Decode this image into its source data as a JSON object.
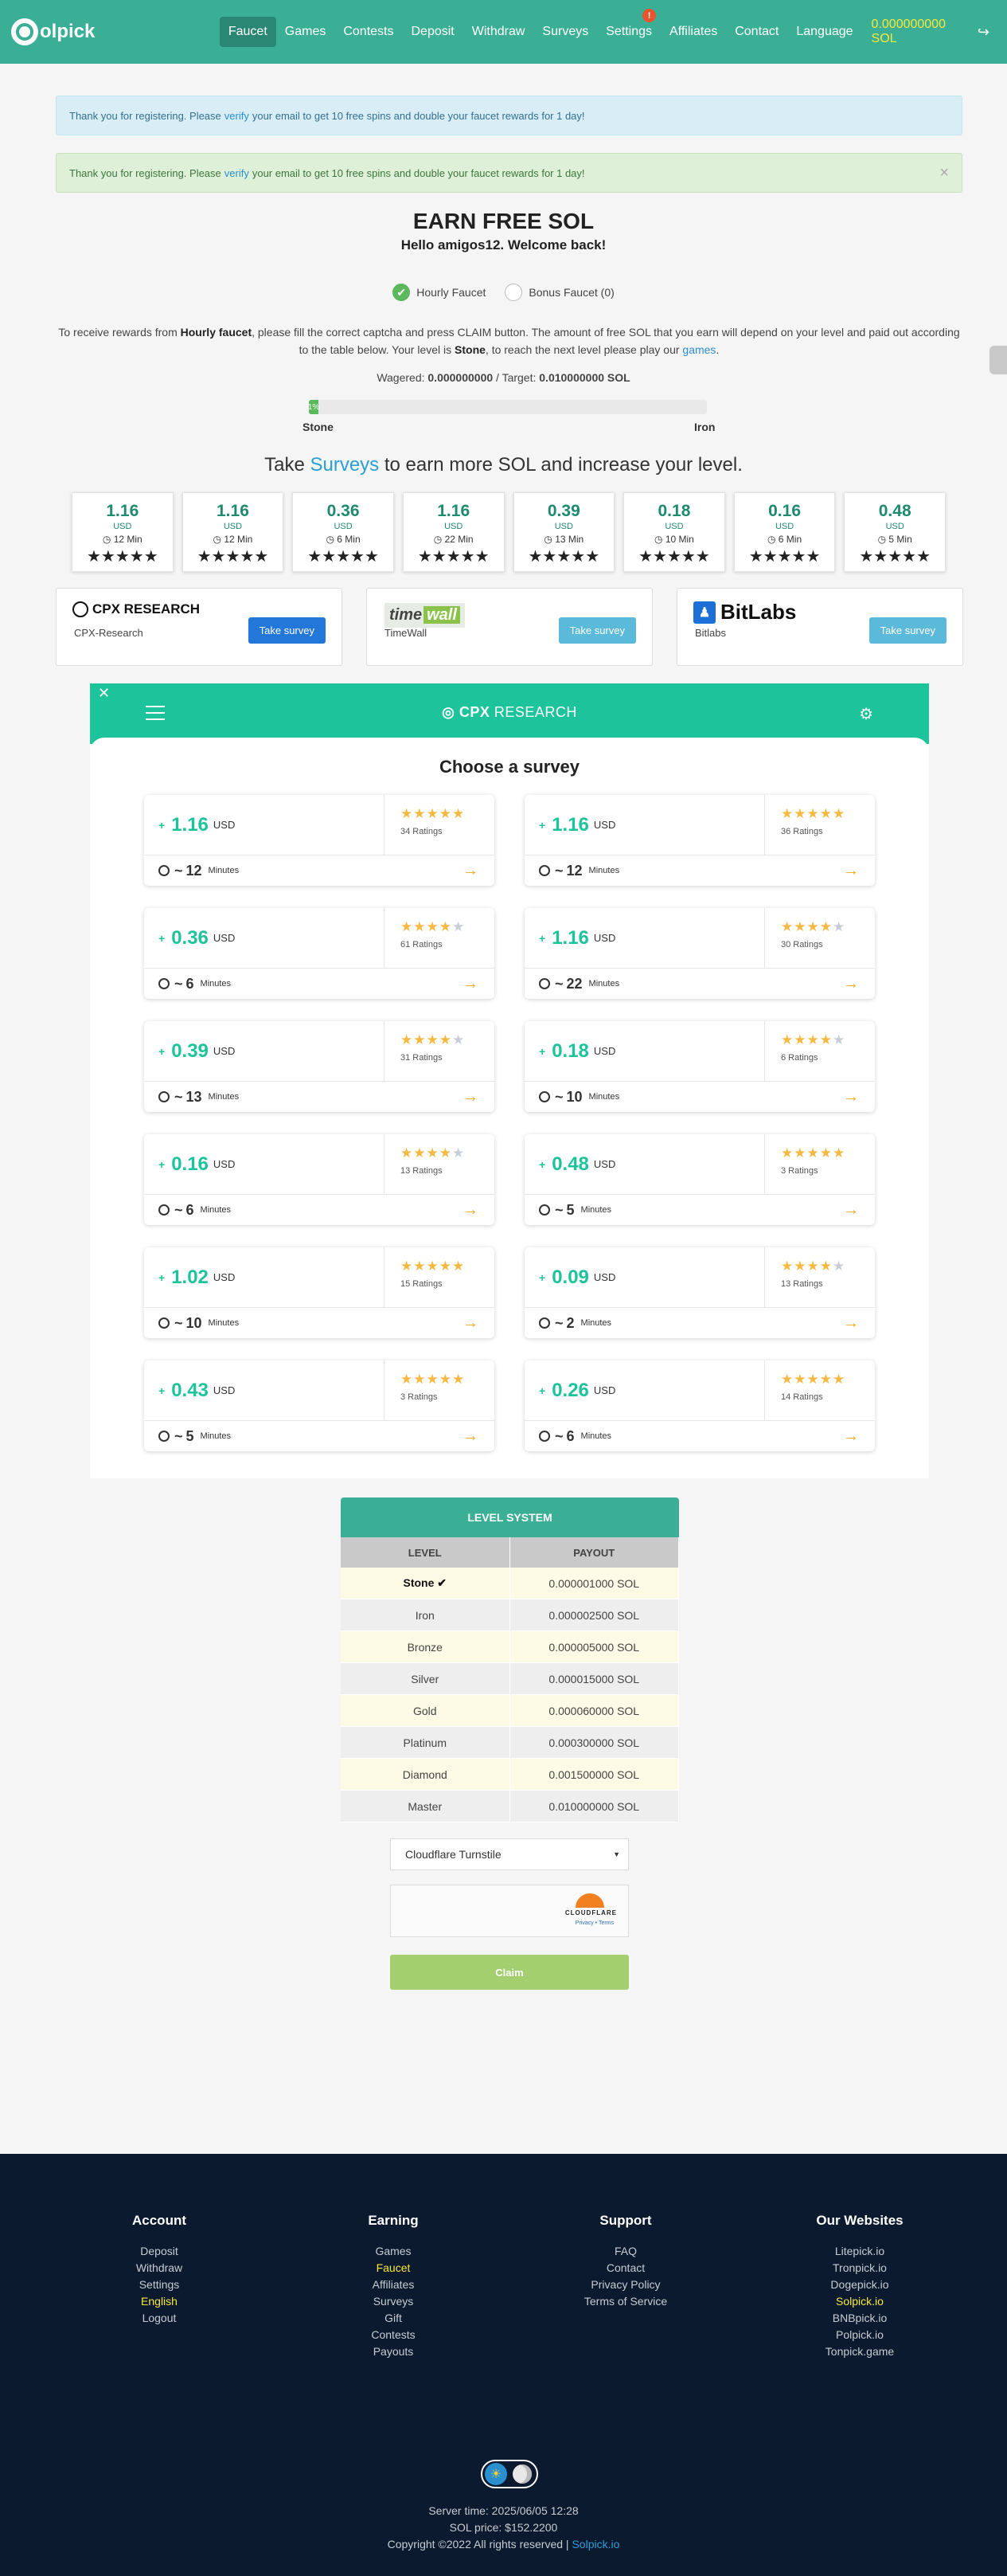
{
  "nav": {
    "logo_text": "olpick",
    "items": [
      {
        "label": "Faucet",
        "active": true
      },
      {
        "label": "Games"
      },
      {
        "label": "Contests"
      },
      {
        "label": "Deposit"
      },
      {
        "label": "Withdraw"
      },
      {
        "label": "Surveys"
      },
      {
        "label": "Settings",
        "badge": "!"
      },
      {
        "label": "Affiliates"
      },
      {
        "label": "Contact"
      },
      {
        "label": "Language"
      }
    ],
    "balance": "0.000000000 SOL"
  },
  "alerts": {
    "info": {
      "before": "Thank you for registering. Please",
      "link": "verify",
      "after": "your email to get 10 free spins and double your faucet rewards for 1 day!"
    },
    "success": {
      "before": "Thank you for registering. Please",
      "link": "verify",
      "after": "your email to get 10 free spins and double your faucet rewards for 1 day!",
      "close": "×"
    }
  },
  "main": {
    "title": "EARN FREE SOL",
    "greeting": "Hello amigos12. Welcome back!",
    "faucet_options": [
      "Hourly Faucet",
      "Bonus Faucet (0)"
    ],
    "desc": {
      "p1": "To receive rewards from",
      "b1": "Hourly faucet",
      "p2": ", please fill the correct captcha and press CLAIM button. The amount of free SOL that you earn will depend on your level and paid out according to the table below. Your level is",
      "b2": "Stone",
      "p3": ", to reach the next level please play our",
      "link": "games",
      "p4": "."
    },
    "wagered_label": "Wagered:",
    "wagered": "0.000000000",
    "target_label": "/ Target:",
    "target": "0.010000000 SOL",
    "progress": {
      "percent": 1,
      "label": "1%",
      "from": "Stone",
      "to": "Iron"
    },
    "take": {
      "before": "Take",
      "link": "Surveys",
      "after": "to earn more SOL and increase your level."
    }
  },
  "mini_surveys": [
    {
      "value": "1.16",
      "unit": "USD",
      "time": "12 Min",
      "stars": "★★★★★"
    },
    {
      "value": "1.16",
      "unit": "USD",
      "time": "12 Min",
      "stars": "★★★★★"
    },
    {
      "value": "0.36",
      "unit": "USD",
      "time": "6 Min",
      "stars": "★★★★★"
    },
    {
      "value": "1.16",
      "unit": "USD",
      "time": "22 Min",
      "stars": "★★★★★"
    },
    {
      "value": "0.39",
      "unit": "USD",
      "time": "13 Min",
      "stars": "★★★★★"
    },
    {
      "value": "0.18",
      "unit": "USD",
      "time": "10 Min",
      "stars": "★★★★★"
    },
    {
      "value": "0.16",
      "unit": "USD",
      "time": "6 Min",
      "stars": "★★★★★"
    },
    {
      "value": "0.48",
      "unit": "USD",
      "time": "5 Min",
      "stars": "★★★★★"
    }
  ],
  "providers": [
    {
      "logo": "CPX RESEARCH",
      "name": "CPX-Research",
      "button": "Take survey"
    },
    {
      "logo_a": "time",
      "logo_b": "wall",
      "name": "TimeWall",
      "button": "Take survey"
    },
    {
      "logo": "BitLabs",
      "logo_mark": "♟",
      "name": "Bitlabs",
      "button": "Take survey"
    }
  ],
  "cpx": {
    "close": "✕",
    "brand_a": "CPX",
    "brand_b": "RESEARCH",
    "filter": "⚙",
    "heading": "Choose a survey",
    "surveys": [
      {
        "amount": "1.16",
        "currency": "USD",
        "rating": 5,
        "ratings": "34 Ratings",
        "minutes": "12",
        "min_label": "Minutes"
      },
      {
        "amount": "1.16",
        "currency": "USD",
        "rating": 5,
        "ratings": "36 Ratings",
        "minutes": "12",
        "min_label": "Minutes"
      },
      {
        "amount": "0.36",
        "currency": "USD",
        "rating": 4,
        "ratings": "61 Ratings",
        "minutes": "6",
        "min_label": "Minutes"
      },
      {
        "amount": "1.16",
        "currency": "USD",
        "rating": 4,
        "ratings": "30 Ratings",
        "minutes": "22",
        "min_label": "Minutes"
      },
      {
        "amount": "0.39",
        "currency": "USD",
        "rating": 4,
        "ratings": "31 Ratings",
        "minutes": "13",
        "min_label": "Minutes"
      },
      {
        "amount": "0.18",
        "currency": "USD",
        "rating": 4,
        "ratings": "6 Ratings",
        "minutes": "10",
        "min_label": "Minutes"
      },
      {
        "amount": "0.16",
        "currency": "USD",
        "rating": 4,
        "ratings": "13 Ratings",
        "minutes": "6",
        "min_label": "Minutes"
      },
      {
        "amount": "0.48",
        "currency": "USD",
        "rating": 5,
        "ratings": "3 Ratings",
        "minutes": "5",
        "min_label": "Minutes"
      },
      {
        "amount": "1.02",
        "currency": "USD",
        "rating": 5,
        "ratings": "15 Ratings",
        "minutes": "10",
        "min_label": "Minutes"
      },
      {
        "amount": "0.09",
        "currency": "USD",
        "rating": 4,
        "ratings": "13 Ratings",
        "minutes": "2",
        "min_label": "Minutes"
      },
      {
        "amount": "0.43",
        "currency": "USD",
        "rating": 5,
        "ratings": "3 Ratings",
        "minutes": "5",
        "min_label": "Minutes"
      },
      {
        "amount": "0.26",
        "currency": "USD",
        "rating": 5,
        "ratings": "14 Ratings",
        "minutes": "6",
        "min_label": "Minutes"
      }
    ]
  },
  "level_system": {
    "title": "LEVEL SYSTEM",
    "col_level": "LEVEL",
    "col_payout": "PAYOUT",
    "rows": [
      {
        "level": "Stone ✔",
        "payout": "0.000001000 SOL",
        "current": true
      },
      {
        "level": "Iron",
        "payout": "0.000002500 SOL"
      },
      {
        "level": "Bronze",
        "payout": "0.000005000 SOL"
      },
      {
        "level": "Silver",
        "payout": "0.000015000 SOL"
      },
      {
        "level": "Gold",
        "payout": "0.000060000 SOL"
      },
      {
        "level": "Platinum",
        "payout": "0.000300000 SOL"
      },
      {
        "level": "Diamond",
        "payout": "0.001500000 SOL"
      },
      {
        "level": "Master",
        "payout": "0.010000000 SOL"
      }
    ]
  },
  "captcha": {
    "selected": "Cloudflare Turnstile",
    "caret": "▼",
    "cf_brand": "CLOUDFLARE",
    "cf_links": "Privacy • Terms",
    "claim": "Claim"
  },
  "footer": {
    "columns": [
      {
        "title": "Account",
        "links": [
          {
            "t": "Deposit"
          },
          {
            "t": "Withdraw"
          },
          {
            "t": "Settings"
          },
          {
            "t": "English",
            "hl": true
          },
          {
            "t": "Logout"
          }
        ]
      },
      {
        "title": "Earning",
        "links": [
          {
            "t": "Games"
          },
          {
            "t": "Faucet",
            "hl": true
          },
          {
            "t": "Affiliates"
          },
          {
            "t": "Surveys"
          },
          {
            "t": "Gift"
          },
          {
            "t": "Contests"
          },
          {
            "t": "Payouts"
          }
        ]
      },
      {
        "title": "Support",
        "links": [
          {
            "t": "FAQ"
          },
          {
            "t": "Contact"
          },
          {
            "t": "Privacy Policy"
          },
          {
            "t": "Terms of Service"
          }
        ]
      },
      {
        "title": "Our Websites",
        "links": [
          {
            "t": "Litepick.io"
          },
          {
            "t": "Tronpick.io"
          },
          {
            "t": "Dogepick.io"
          },
          {
            "t": "Solpick.io",
            "hl": true
          },
          {
            "t": "BNBpick.io"
          },
          {
            "t": "Polpick.io"
          },
          {
            "t": "Tonpick.game"
          }
        ]
      }
    ],
    "server_time": "Server time: 2025/06/05 12:28",
    "sol_price": "SOL price: $152.2200",
    "copyright": "Copyright ©2022 All rights reserved |",
    "copyright_link": "Solpick.io"
  },
  "colors": {
    "brand": "#3aaf96",
    "cpx": "#1cc39b",
    "balance": "#f7e83a",
    "footer": "#0b1a2f"
  }
}
